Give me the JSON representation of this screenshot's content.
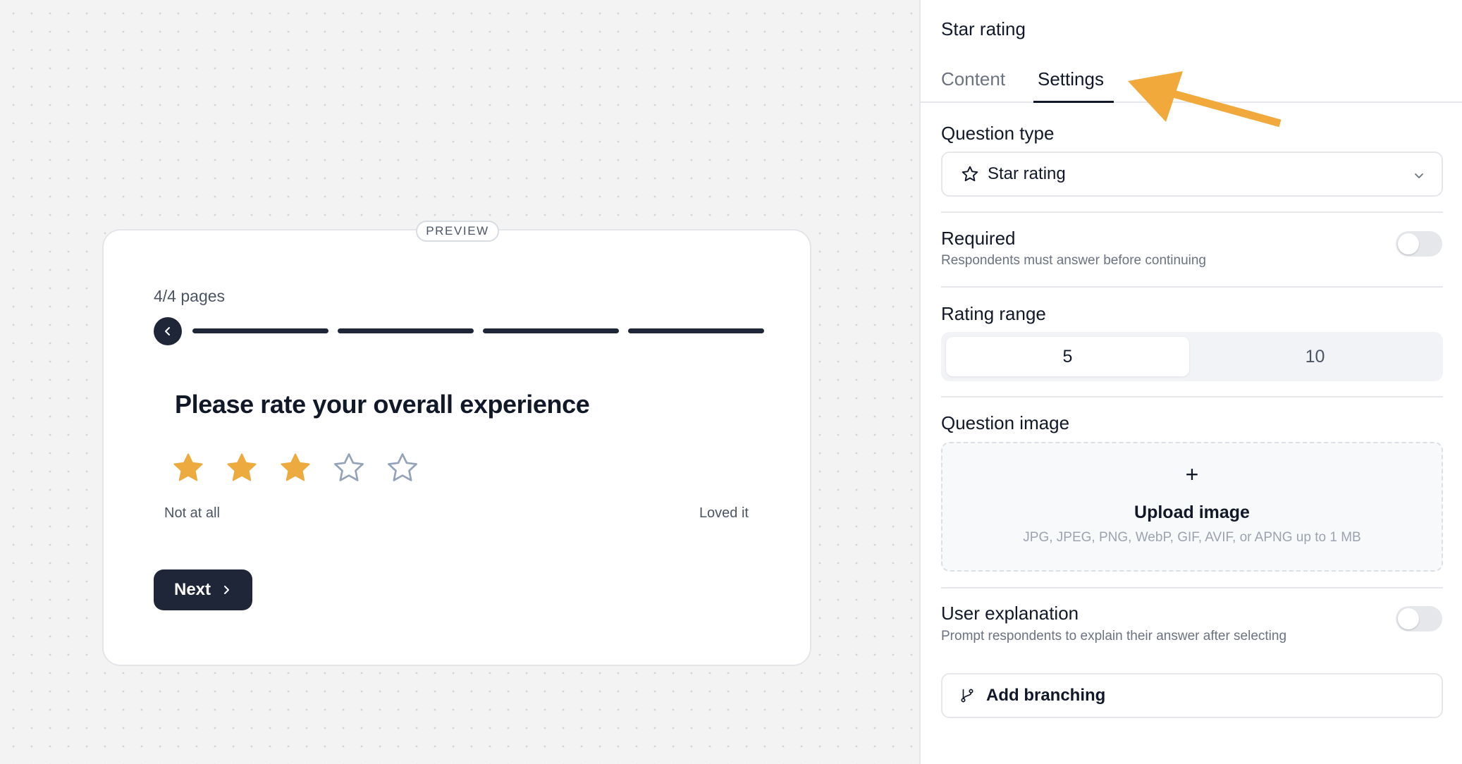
{
  "preview": {
    "badge": "PREVIEW",
    "pages_label": "4/4 pages",
    "progress_segments": 4,
    "question": "Please rate your overall experience",
    "rating": {
      "value": 3,
      "max": 5
    },
    "scale_low": "Not at all",
    "scale_high": "Loved it",
    "next_label": "Next"
  },
  "panel": {
    "title": "Star rating",
    "tabs": [
      {
        "label": "Content",
        "active": false
      },
      {
        "label": "Settings",
        "active": true
      }
    ],
    "question_type": {
      "label": "Question type",
      "value": "Star rating"
    },
    "required": {
      "label": "Required",
      "description": "Respondents must answer before continuing",
      "enabled": false
    },
    "rating_range": {
      "label": "Rating range",
      "options": [
        "5",
        "10"
      ],
      "selected": "5"
    },
    "question_image": {
      "label": "Question image",
      "plus": "+",
      "upload_label": "Upload image",
      "hint": "JPG, JPEG, PNG, WebP, GIF, AVIF, or APNG up to 1 MB"
    },
    "user_explanation": {
      "label": "User explanation",
      "description": "Prompt respondents to explain their answer after selecting",
      "enabled": false
    },
    "branching": {
      "label": "Add branching"
    }
  },
  "colors": {
    "star_filled": "#EDAA3F",
    "star_empty": "#94A3B8",
    "primary_dark": "#1F2637",
    "annotation_arrow": "#F2A93B"
  },
  "icons": {
    "back": "chevron-left-icon",
    "next": "chevron-right-icon",
    "question_type": "star-icon",
    "select": "chevron-down-icon",
    "branching": "git-branch-icon"
  }
}
